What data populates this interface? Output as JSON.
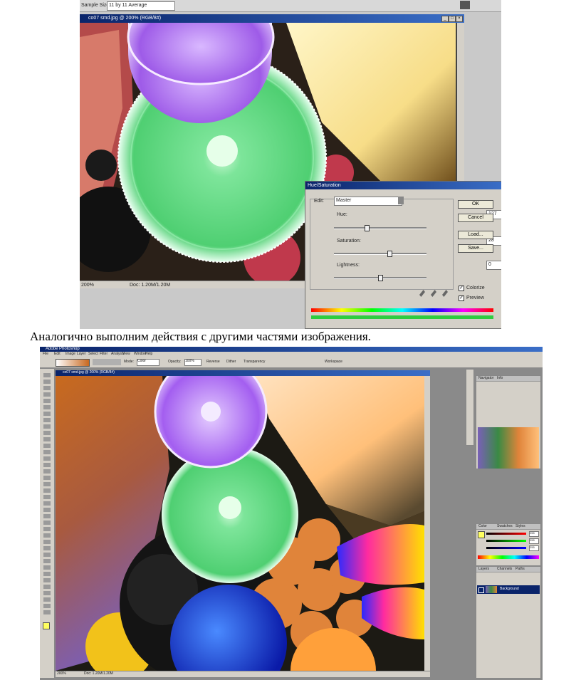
{
  "top_window": {
    "options_bar": {
      "sample_size_label": "Sample Size:",
      "sample_size_value": "11 by 11 Average"
    },
    "document_title": "co07 smd.jpg @ 200% (RGB/8#)",
    "status": {
      "zoom": "200%",
      "doc_size": "Doc: 1.20M/1.20M"
    },
    "hue_saturation": {
      "title": "Hue/Saturation",
      "edit_label": "Edit:",
      "edit_value": "Master",
      "hue_label": "Hue:",
      "hue_value": "127",
      "hue_position": 0.35,
      "saturation_label": "Saturation:",
      "saturation_value": "28",
      "saturation_position": 0.6,
      "lightness_label": "Lightness:",
      "lightness_value": "0",
      "lightness_position": 0.5,
      "buttons": {
        "ok": "OK",
        "cancel": "Cancel",
        "load": "Load...",
        "save": "Save..."
      },
      "colorize_label": "Colorize",
      "colorize_checked": true,
      "preview_label": "Preview",
      "preview_checked": true
    }
  },
  "caption": "Аналогично выполним действия с другими частями изображения.",
  "bottom_window": {
    "app_title": "Adobe Photoshop",
    "menu": [
      "File",
      "Edit",
      "Image",
      "Layer",
      "Select",
      "Filter",
      "Analysis",
      "View",
      "Window",
      "Help"
    ],
    "options_bar": {
      "mode_label": "Mode:",
      "mode_value": "Color",
      "opacity_label": "Opacity:",
      "opacity_value": "100%",
      "reverse_label": "Reverse",
      "dither_label": "Dither",
      "transparency_label": "Transparency",
      "workspace_label": "Workspace"
    },
    "document_title": "co07 smd.jpg @ 200% (RGB/8#)",
    "status": {
      "zoom": "200%",
      "doc_size": "Doc: 1.20M/1.20M"
    },
    "navigator_tabs": [
      "Navigator",
      "Info"
    ],
    "color_tabs": [
      "Color",
      "Swatches",
      "Styles"
    ],
    "color_values": {
      "r": "255",
      "g": "255",
      "b": "255"
    },
    "layers_tabs": [
      "Layers",
      "Channels",
      "Paths"
    ],
    "layer_name": "Background"
  }
}
